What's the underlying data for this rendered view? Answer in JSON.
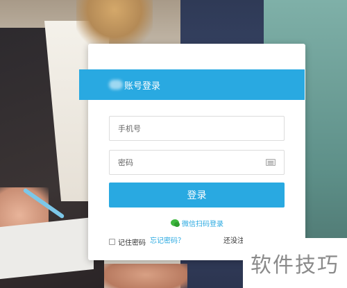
{
  "login": {
    "title": "账号登录",
    "phone_placeholder": "手机号",
    "password_placeholder": "密码",
    "submit_label": "登录",
    "wechat_label": "微信扫码登录",
    "remember_label": "记住密码",
    "forgot_label": "忘记密码？",
    "register_label": "还没注"
  },
  "watermark": {
    "text": "软件技巧"
  },
  "colors": {
    "accent": "#29a9e1",
    "card": "#ffffff",
    "wechat_green": "#3fb83f"
  },
  "icons": {
    "password_field": "keyboard-icon",
    "wechat": "wechat-icon"
  }
}
